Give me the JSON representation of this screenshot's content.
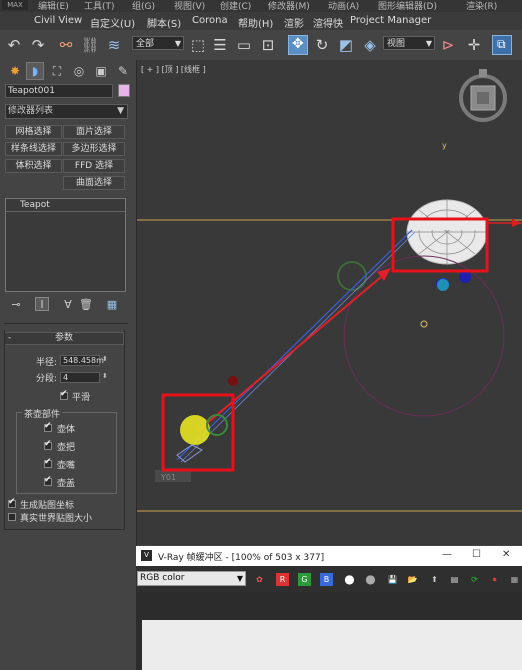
{
  "menubar": {
    "logo": "MAX",
    "row1": [
      "编辑(E)",
      "工具(T)",
      "组(G)",
      "视图(V)",
      "创建(C)",
      "修改器(M)",
      "动画(A)",
      "图形编辑器(D)",
      "渲染(R)"
    ],
    "row2": [
      "Civil View",
      "自定义(U)",
      "脚本(S)",
      "Corona",
      "帮助(H)",
      "渲影",
      "渲得快",
      "Project Manager"
    ]
  },
  "toolbar": {
    "selection_filter": "全部",
    "ref_coord": "视图",
    "icons": [
      "undo-icon",
      "redo-icon",
      "link-icon",
      "unlink-icon",
      "bind-space-warp-icon",
      "select-object-icon",
      "select-by-name-icon",
      "rect-region-icon",
      "window-crossing-icon",
      "move-icon",
      "rotate-icon",
      "scale-icon",
      "pivot-icon",
      "mirror-icon",
      "align-icon",
      "layer-icon"
    ]
  },
  "command_panel": {
    "tabs": [
      "create-tab",
      "modify-tab",
      "hierarchy-tab",
      "motion-tab",
      "display-tab",
      "utilities-tab"
    ],
    "object_name": "Teapot001",
    "object_color": "#e6b4e8",
    "modifier_list": "修改器列表",
    "mod_buttons": [
      "网格选择",
      "面片选择",
      "样条线选择",
      "多边形选择",
      "体积选择",
      "FFD 选择",
      "曲面选择"
    ],
    "stack_item": "Teapot",
    "params": {
      "rollout_title": "参数",
      "radius_label": "半径:",
      "radius_value": "548.458m",
      "segments_label": "分段:",
      "segments_value": "4",
      "smooth_label": "平滑",
      "parts_title": "茶壶部件",
      "parts": [
        "壶体",
        "壶把",
        "壶嘴",
        "壶盖"
      ],
      "gen_mapping": "生成贴图坐标",
      "real_world": "真实世界贴图大小"
    }
  },
  "viewport": {
    "label": "[ + ] [顶 ] [线框 ]",
    "axis_y": "y",
    "bottom_tag": "Y01"
  },
  "vray": {
    "title": "V-Ray 帧缓冲区 - [100% of 503 x 377]",
    "channel": "RGB color",
    "rgb_buttons": [
      "R",
      "G",
      "B"
    ],
    "win_buttons": [
      "—",
      "☐",
      "✕"
    ]
  },
  "colors": {
    "highlight": "#e8111b",
    "arrow": "#e0202a",
    "line": "#3a5fd8",
    "camera": "#f2ee22",
    "frame": "#c9a44a"
  }
}
